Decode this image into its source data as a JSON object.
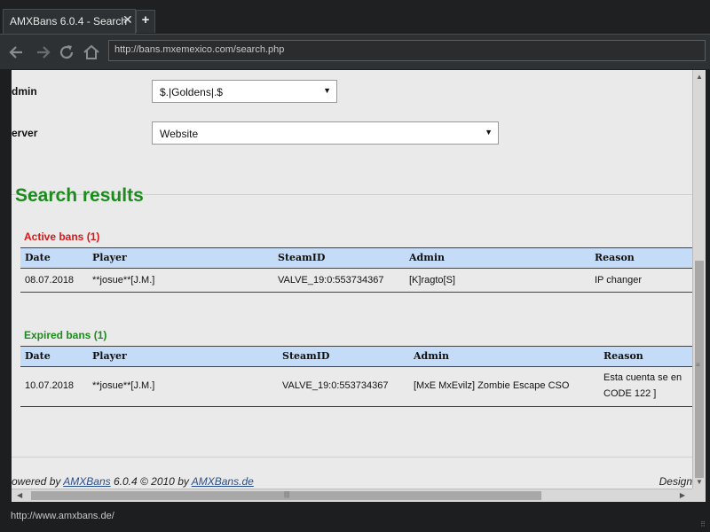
{
  "browser": {
    "tab_title": "AMXBans 6.0.4 - Search",
    "tab_close": "✕",
    "new_tab": "+",
    "url": "http://bans.mxemexico.com/search.php",
    "status_url": "http://www.amxbans.de/"
  },
  "form": {
    "admin_label": "dmin",
    "admin_value": "$.|Goldens|.$",
    "server_label": "erver",
    "server_value": "Website"
  },
  "results": {
    "title": "Search results",
    "active": {
      "title": "Active bans (1)",
      "headers": [
        "Date",
        "Player",
        "SteamID",
        "Admin",
        "Reason"
      ],
      "rows": [
        {
          "date": "08.07.2018",
          "player": "**josue**[J.M.]",
          "steamid": "VALVE_19:0:553734367",
          "admin": "[K]ragto[S]",
          "reason": "IP changer"
        }
      ]
    },
    "expired": {
      "title": "Expired bans (1)",
      "headers": [
        "Date",
        "Player",
        "SteamID",
        "Admin",
        "Reason"
      ],
      "rows": [
        {
          "date": "10.07.2018",
          "player": "**josue**[J.M.]",
          "steamid": "VALVE_19:0:553734367",
          "admin": "[MxE MxEvilz] Zombie Escape CSO",
          "reason_line1": "Esta cuenta se en",
          "reason_line2": "CODE 122 ]"
        }
      ]
    }
  },
  "footer": {
    "prefix": "owered by ",
    "amxbans_link": "AMXBans",
    "middle": " 6.0.4 © 2010 by ",
    "site_link": "AMXBans.de",
    "right": "Design"
  },
  "colors": {
    "results_title": "#1c8a1c",
    "active_title": "#d81818",
    "expired_title": "#1c8a1c",
    "table_header_bg": "#c4dcf8",
    "page_bg": "#eaeaea"
  }
}
